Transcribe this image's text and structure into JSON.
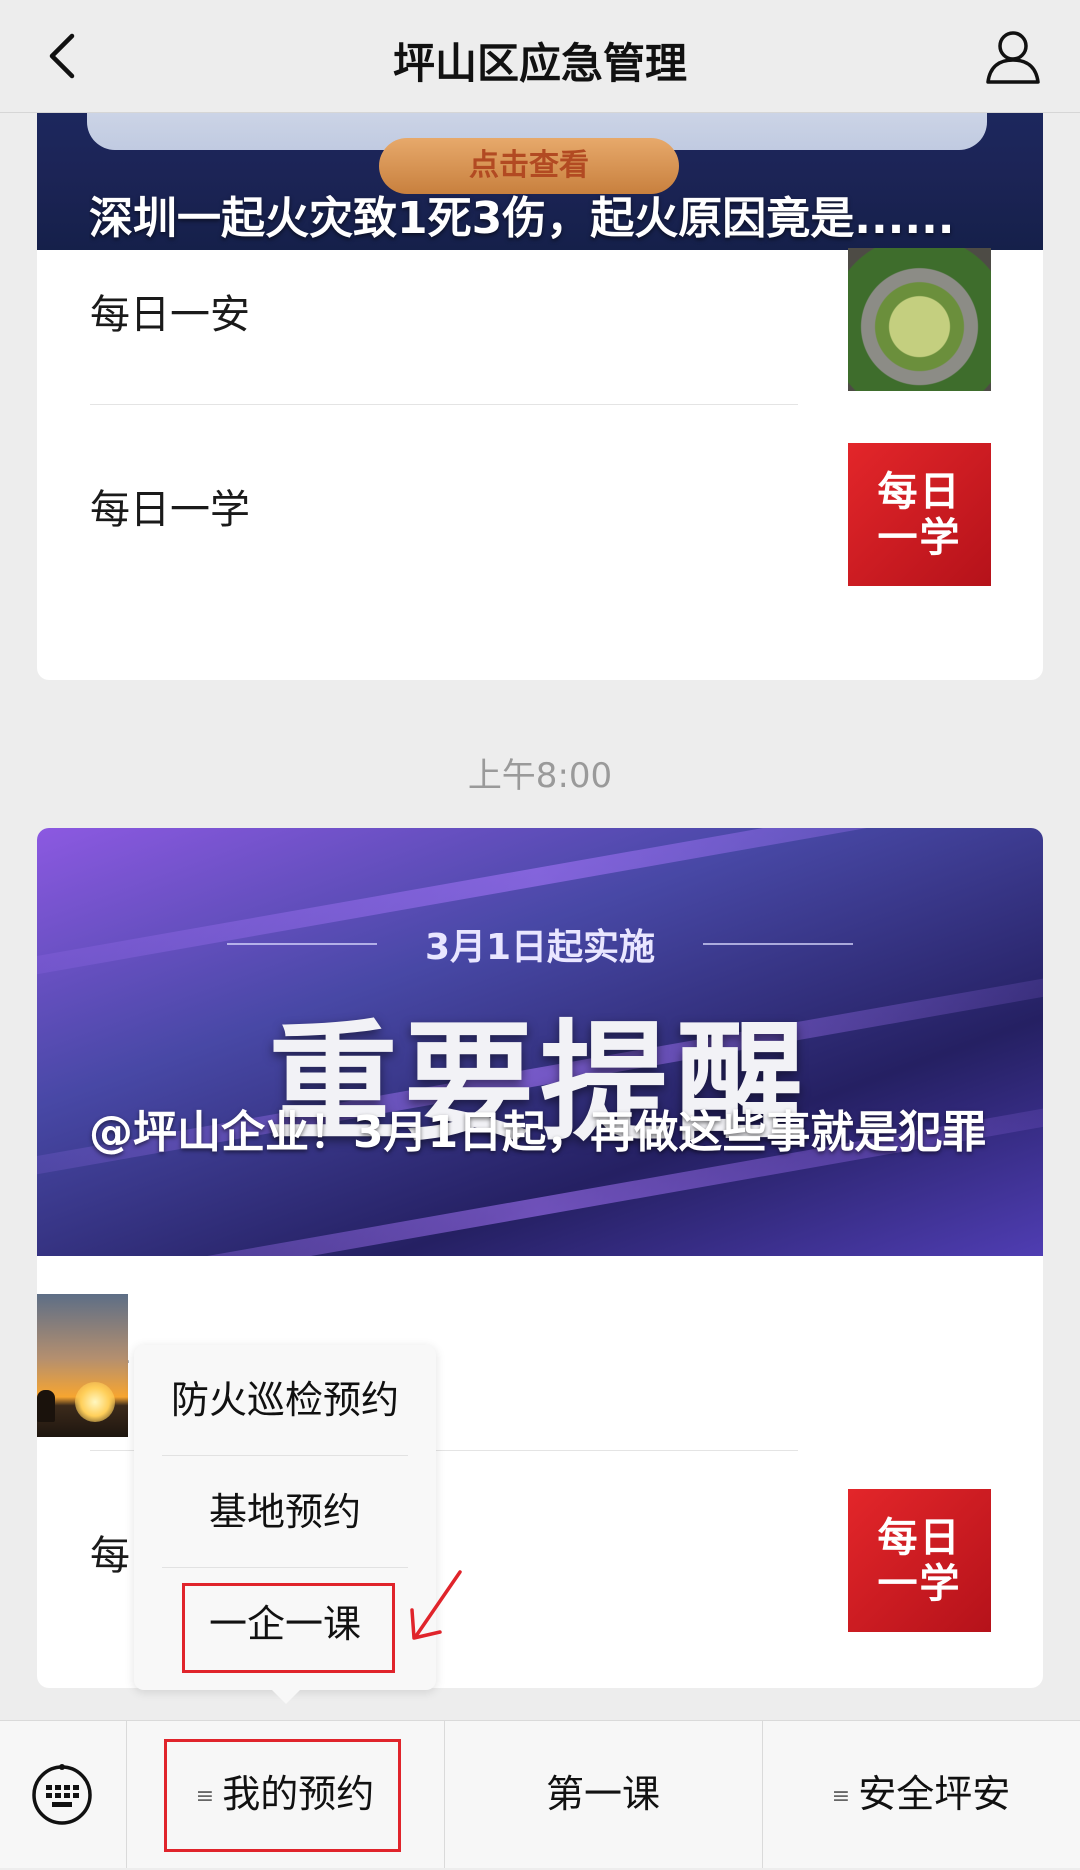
{
  "header": {
    "title": "坪山区应急管理"
  },
  "card1": {
    "banner_button": "点击查看",
    "banner_title": "深圳一起火灾致1死3伤，起火原因竟是......",
    "items": [
      {
        "label": "每日一安",
        "thumb": "aerial-roundabout-photo"
      },
      {
        "label": "每日一学",
        "thumb_text_1": "每日",
        "thumb_text_2": "一学"
      }
    ]
  },
  "timestamp": "上午8:00",
  "card2": {
    "banner_sub": "3月1日起实施",
    "banner_big": "重要提醒",
    "banner_title": "@坪山企业！3月1日起，再做这些事就是犯罪",
    "items": [
      {
        "label": "每",
        "thumb": "sunset-workers-photo"
      },
      {
        "label": "每",
        "thumb_text_1": "每日",
        "thumb_text_2": "一学"
      }
    ]
  },
  "popup_menu": {
    "items": [
      "防火巡检预约",
      "基地预约",
      "一企一课"
    ],
    "highlighted": "一企一课"
  },
  "bottom_menu": {
    "keyboard_icon": "keyboard-icon",
    "buttons": [
      {
        "label": "我的预约",
        "has_submenu": true
      },
      {
        "label": "第一课",
        "has_submenu": false
      },
      {
        "label": "安全坪安",
        "has_submenu": true
      }
    ],
    "submenu_marker": "≡"
  },
  "colors": {
    "highlight": "#e0242b",
    "background": "#ededed"
  }
}
